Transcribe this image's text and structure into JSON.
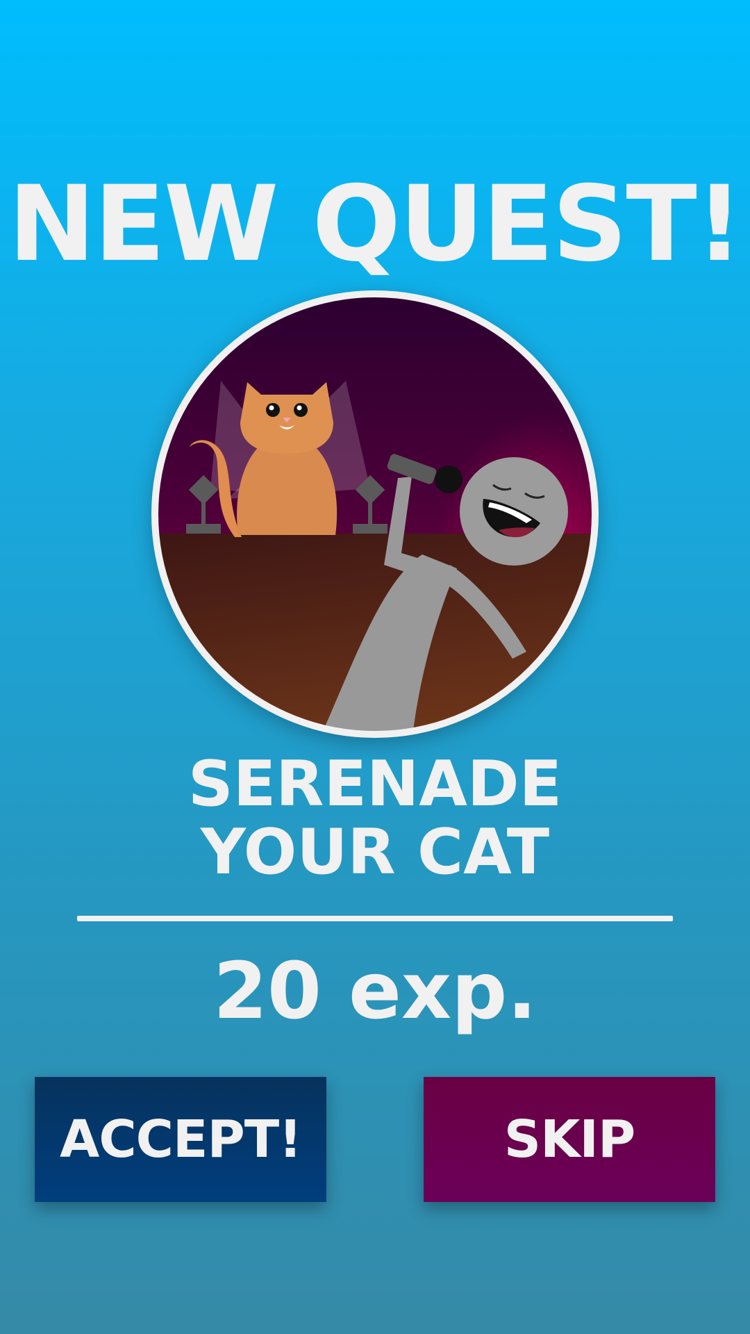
{
  "header": {
    "title": "NEW QUEST!"
  },
  "quest": {
    "illustration": "cat-serenade-illustration",
    "name_line1": "SERENADE",
    "name_line2": "YOUR CAT",
    "reward": "20 exp."
  },
  "actions": {
    "accept_label": "ACCEPT!",
    "skip_label": "SKIP"
  },
  "colors": {
    "accept": "#003e7d",
    "skip": "#6b0059",
    "text": "#f1f1f1",
    "background_top": "#00bdfd",
    "background_bottom": "#358aa7"
  }
}
